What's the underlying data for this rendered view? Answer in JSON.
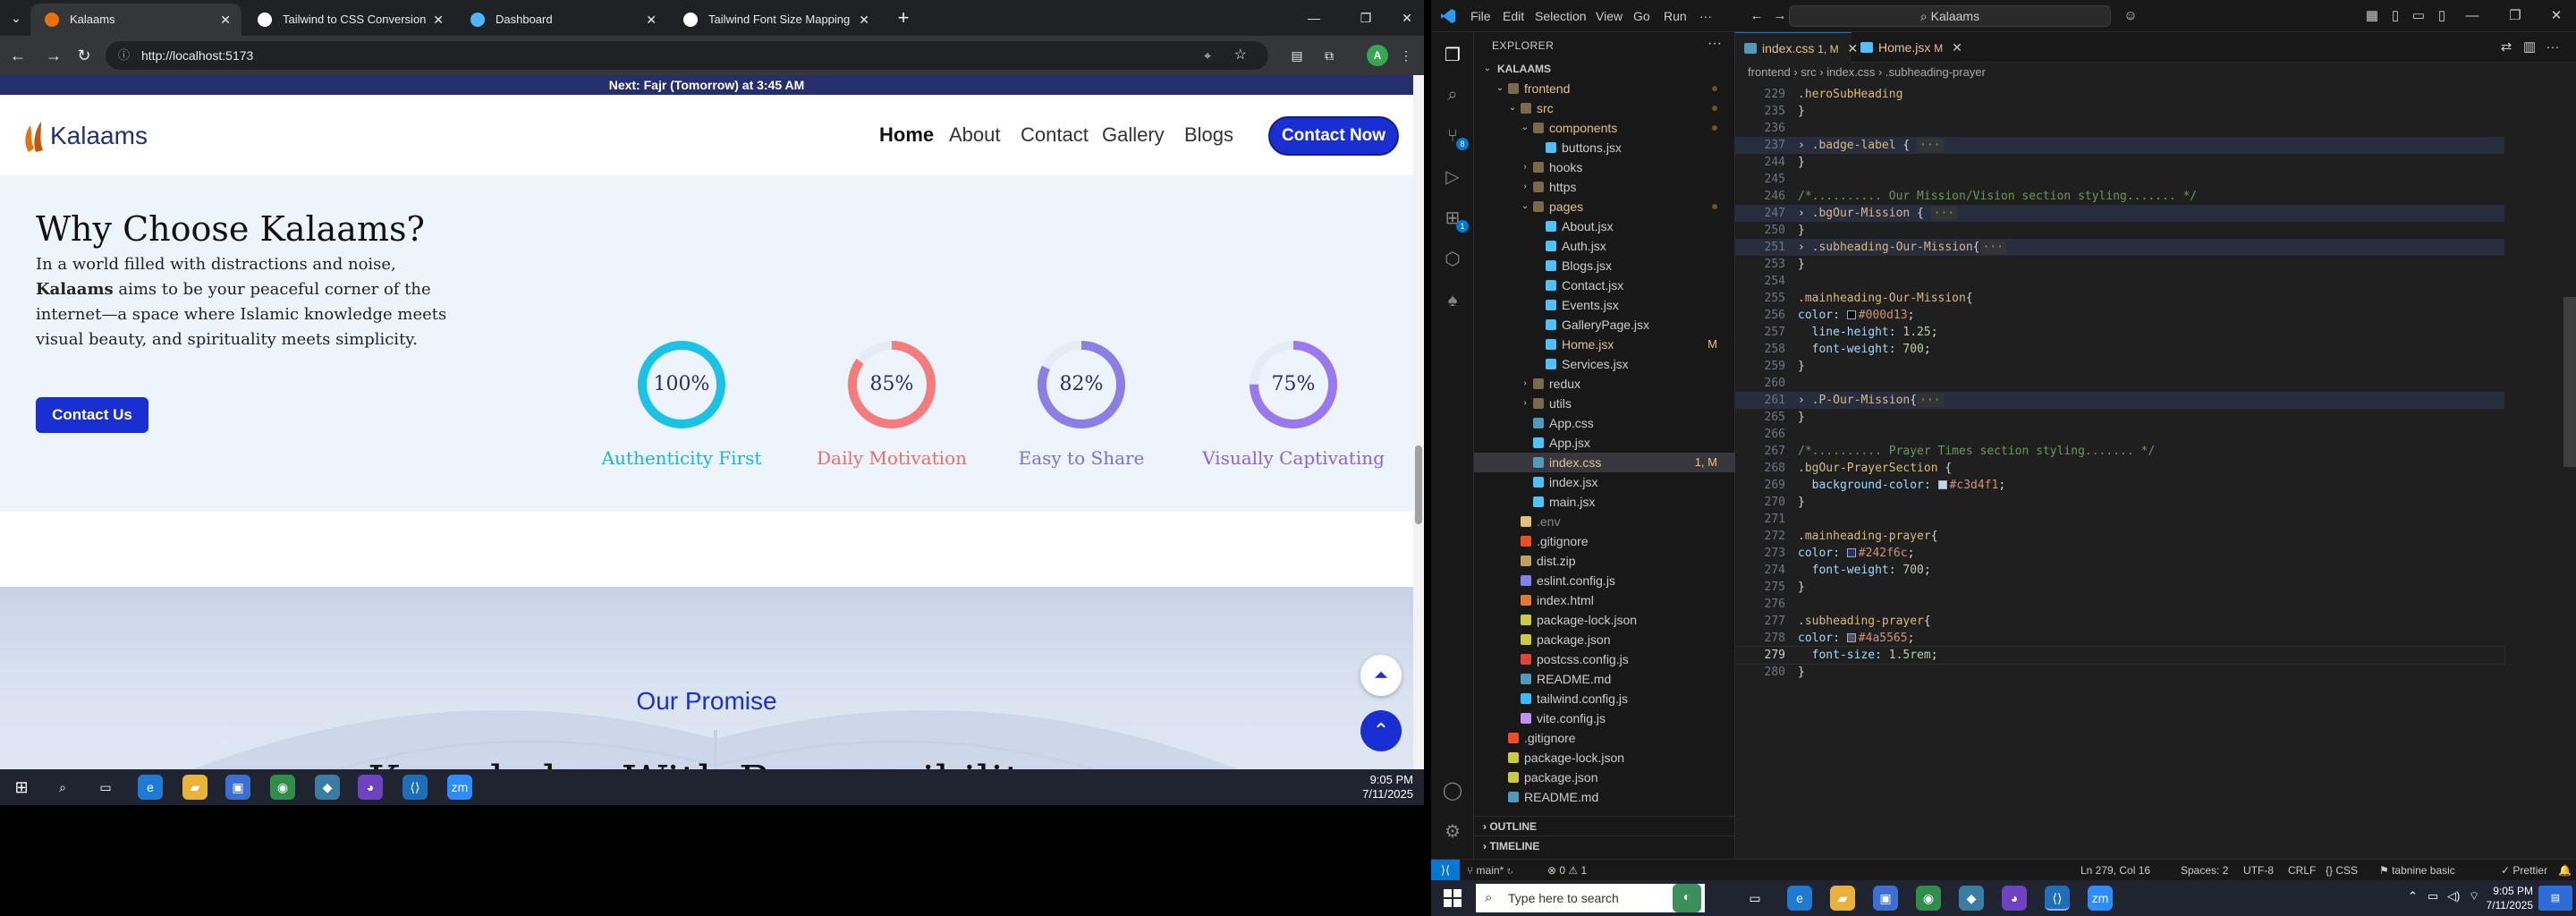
{
  "browser": {
    "tabs": [
      {
        "title": "Kalaams",
        "favicon_color": "#e8710a",
        "active": true
      },
      {
        "title": "Tailwind to CSS Conversion",
        "favicon_color": "#ffffff",
        "active": false
      },
      {
        "title": "Dashboard",
        "favicon_color": "#4db6ff",
        "active": false
      },
      {
        "title": "Tailwind Font Size Mapping",
        "favicon_color": "#ffffff",
        "active": false
      }
    ],
    "url": "http://localhost:5173",
    "avatar_letter": "A"
  },
  "site": {
    "notice_prefix": "Next: ",
    "notice_bold": "Fajr (Tomorrow)",
    "notice_suffix": " at 3:45 AM",
    "logo_text": "Kalaams",
    "nav": [
      "Home",
      "About",
      "Contact",
      "Gallery",
      "Blogs"
    ],
    "cta": "Contact Now",
    "why_title": "Why Choose Kalaams?",
    "why_p1": "In a world filled with distractions and noise,",
    "why_bold": "Kalaams",
    "why_p2": " aims to be your peaceful corner of the internet—a space where Islamic knowledge meets visual beauty, and spirituality meets simplicity.",
    "contact_btn": "Contact Us",
    "stats": [
      {
        "value": 100,
        "label": "100%",
        "title": "Authenticity First",
        "color": "#1ac3e6",
        "title_color": "#1bb4d4"
      },
      {
        "value": 85,
        "label": "85%",
        "title": "Daily Motivation",
        "color": "#f47c7c",
        "title_color": "#f06a6a"
      },
      {
        "value": 82,
        "label": "82%",
        "title": "Easy to Share",
        "color": "#8b7fe6",
        "title_color": "#7a6fde"
      },
      {
        "value": 75,
        "label": "75%",
        "title": "Visually Captivating",
        "color": "#9a78ee",
        "title_color": "#8a62e6"
      }
    ],
    "promise_sub": "Our Promise",
    "promise_title": "Knowledge With Responsibility"
  },
  "left_taskbar": {
    "time": "9:05 PM",
    "date": "7/11/2025"
  },
  "vscode": {
    "menu": [
      "File",
      "Edit",
      "Selection",
      "View",
      "Go",
      "Run",
      "···"
    ],
    "search": "Kalaams",
    "explorer_title": "EXPLORER",
    "tree": [
      {
        "depth": 0,
        "type": "folder-open",
        "name": "KALAAMS",
        "bold": true
      },
      {
        "depth": 1,
        "type": "folder-open",
        "name": "frontend",
        "color": "#e2c08d",
        "dot": true
      },
      {
        "depth": 2,
        "type": "folder-open",
        "name": "src",
        "color": "#e2c08d",
        "dot": true
      },
      {
        "depth": 3,
        "type": "folder-open",
        "name": "components",
        "color": "#e2c08d",
        "dot": true
      },
      {
        "depth": 4,
        "type": "file",
        "name": "buttons.jsx",
        "icon": "#4fc1ff"
      },
      {
        "depth": 3,
        "type": "folder",
        "name": "hooks"
      },
      {
        "depth": 3,
        "type": "folder",
        "name": "https"
      },
      {
        "depth": 3,
        "type": "folder-open",
        "name": "pages",
        "color": "#e2c08d",
        "dot": true
      },
      {
        "depth": 4,
        "type": "file",
        "name": "About.jsx",
        "icon": "#4fc1ff"
      },
      {
        "depth": 4,
        "type": "file",
        "name": "Auth.jsx",
        "icon": "#4fc1ff"
      },
      {
        "depth": 4,
        "type": "file",
        "name": "Blogs.jsx",
        "icon": "#4fc1ff"
      },
      {
        "depth": 4,
        "type": "file",
        "name": "Contact.jsx",
        "icon": "#4fc1ff"
      },
      {
        "depth": 4,
        "type": "file",
        "name": "Events.jsx",
        "icon": "#4fc1ff"
      },
      {
        "depth": 4,
        "type": "file",
        "name": "GalleryPage.jsx",
        "icon": "#4fc1ff"
      },
      {
        "depth": 4,
        "type": "file",
        "name": "Home.jsx",
        "icon": "#4fc1ff",
        "color": "#e2c08d",
        "status": "M",
        "status_color": "#e2c08d"
      },
      {
        "depth": 4,
        "type": "file",
        "name": "Services.jsx",
        "icon": "#4fc1ff"
      },
      {
        "depth": 3,
        "type": "folder",
        "name": "redux"
      },
      {
        "depth": 3,
        "type": "folder",
        "name": "utils"
      },
      {
        "depth": 3,
        "type": "file",
        "name": "App.css",
        "icon": "#519aba"
      },
      {
        "depth": 3,
        "type": "file",
        "name": "App.jsx",
        "icon": "#4fc1ff"
      },
      {
        "depth": 3,
        "type": "file",
        "name": "index.css",
        "icon": "#519aba",
        "color": "#e2c08d",
        "status": "1, M",
        "status_color": "#e2c08d",
        "selected": true
      },
      {
        "depth": 3,
        "type": "file",
        "name": "index.jsx",
        "icon": "#4fc1ff"
      },
      {
        "depth": 3,
        "type": "file",
        "name": "main.jsx",
        "icon": "#4fc1ff"
      },
      {
        "depth": 2,
        "type": "file",
        "name": ".env",
        "icon": "#e5c07b",
        "color": "#8b8b8b"
      },
      {
        "depth": 2,
        "type": "file",
        "name": ".gitignore",
        "icon": "#f14c28"
      },
      {
        "depth": 2,
        "type": "file",
        "name": "dist.zip",
        "icon": "#c0a060"
      },
      {
        "depth": 2,
        "type": "file",
        "name": "eslint.config.js",
        "icon": "#8080f0"
      },
      {
        "depth": 2,
        "type": "file",
        "name": "index.html",
        "icon": "#e37933"
      },
      {
        "depth": 2,
        "type": "file",
        "name": "package-lock.json",
        "icon": "#cbcb41"
      },
      {
        "depth": 2,
        "type": "file",
        "name": "package.json",
        "icon": "#cbcb41"
      },
      {
        "depth": 2,
        "type": "file",
        "name": "postcss.config.js",
        "icon": "#e0433c"
      },
      {
        "depth": 2,
        "type": "file",
        "name": "README.md",
        "icon": "#519aba"
      },
      {
        "depth": 2,
        "type": "file",
        "name": "tailwind.config.js",
        "icon": "#38bdf8"
      },
      {
        "depth": 2,
        "type": "file",
        "name": "vite.config.js",
        "icon": "#bd93f9"
      },
      {
        "depth": 1,
        "type": "file",
        "name": ".gitignore",
        "icon": "#f14c28"
      },
      {
        "depth": 1,
        "type": "file",
        "name": "package-lock.json",
        "icon": "#cbcb41"
      },
      {
        "depth": 1,
        "type": "file",
        "name": "package.json",
        "icon": "#cbcb41"
      },
      {
        "depth": 1,
        "type": "file",
        "name": "README.md",
        "icon": "#519aba"
      }
    ],
    "outline": "OUTLINE",
    "timeline": "TIMELINE",
    "tabs": [
      {
        "name": "index.css",
        "badge": "1, M",
        "color": "#e2c08d",
        "icon": "#519aba",
        "active": true
      },
      {
        "name": "Home.jsx",
        "badge": "M",
        "color": "#e2c08d",
        "icon": "#4fc1ff",
        "active": false
      }
    ],
    "breadcrumb": "frontend  ›  src  ›  index.css  ›  .subheading-prayer",
    "lines": [
      {
        "n": "229",
        "parts": [
          {
            "t": ".heroSubHeading",
            "c": "c-sel"
          }
        ]
      },
      {
        "n": "235",
        "parts": [
          {
            "t": "}",
            "c": "c-brace"
          }
        ]
      },
      {
        "n": "236",
        "parts": []
      },
      {
        "n": "237",
        "fold": true,
        "parts": [
          {
            "t": "› ",
            "c": "c-brace"
          },
          {
            "t": ".badge-label",
            "c": "c-sel"
          },
          {
            "t": " { ",
            "c": "c-brace"
          },
          {
            "t": "···",
            "c": "c-fold"
          }
        ]
      },
      {
        "n": "244",
        "parts": [
          {
            "t": "}",
            "c": "c-brace"
          }
        ]
      },
      {
        "n": "245",
        "parts": []
      },
      {
        "n": "246",
        "parts": [
          {
            "t": "/*.......... Our Mission/Vision section styling....... */",
            "c": "c-cmt"
          }
        ]
      },
      {
        "n": "247",
        "fold": true,
        "parts": [
          {
            "t": "› ",
            "c": "c-brace"
          },
          {
            "t": ".bgOur-Mission",
            "c": "c-sel"
          },
          {
            "t": " { ",
            "c": "c-brace"
          },
          {
            "t": "···",
            "c": "c-fold"
          }
        ]
      },
      {
        "n": "250",
        "parts": [
          {
            "t": "}",
            "c": "c-brace"
          }
        ]
      },
      {
        "n": "251",
        "fold": true,
        "parts": [
          {
            "t": "› ",
            "c": "c-brace"
          },
          {
            "t": ".subheading-Our-Mission",
            "c": "c-sel"
          },
          {
            "t": "{",
            "c": "c-brace"
          },
          {
            "t": "···",
            "c": "c-fold"
          }
        ]
      },
      {
        "n": "253",
        "parts": [
          {
            "t": "}",
            "c": "c-brace"
          }
        ]
      },
      {
        "n": "254",
        "parts": []
      },
      {
        "n": "255",
        "parts": [
          {
            "t": ".mainheading-Our-Mission",
            "c": "c-sel"
          },
          {
            "t": "{",
            "c": "c-brace"
          }
        ]
      },
      {
        "n": "256",
        "parts": [
          {
            "t": "color: ",
            "c": "c-prop"
          },
          {
            "t": "■",
            "c": "swatch-000d13"
          },
          {
            "t": "#000d13",
            "c": "c-val"
          },
          {
            "t": ";",
            "c": "c-brace"
          }
        ]
      },
      {
        "n": "257",
        "parts": [
          {
            "t": "  line-height: ",
            "c": "c-prop"
          },
          {
            "t": "1.25",
            "c": "c-num"
          },
          {
            "t": ";",
            "c": "c-brace"
          }
        ]
      },
      {
        "n": "258",
        "parts": [
          {
            "t": "  font-weight: ",
            "c": "c-prop"
          },
          {
            "t": "700",
            "c": "c-num"
          },
          {
            "t": ";",
            "c": "c-brace"
          }
        ]
      },
      {
        "n": "259",
        "parts": [
          {
            "t": "}",
            "c": "c-brace"
          }
        ]
      },
      {
        "n": "260",
        "parts": []
      },
      {
        "n": "261",
        "fold": true,
        "parts": [
          {
            "t": "› ",
            "c": "c-brace"
          },
          {
            "t": ".P-Our-Mission",
            "c": "c-sel"
          },
          {
            "t": "{",
            "c": "c-brace"
          },
          {
            "t": "···",
            "c": "c-fold"
          }
        ]
      },
      {
        "n": "265",
        "parts": [
          {
            "t": "}",
            "c": "c-brace"
          }
        ]
      },
      {
        "n": "266",
        "parts": []
      },
      {
        "n": "267",
        "parts": [
          {
            "t": "/*.......... Prayer Times section styling....... */",
            "c": "c-cmt"
          }
        ]
      },
      {
        "n": "268",
        "parts": [
          {
            "t": ".bgOur-PrayerSection",
            "c": "c-sel"
          },
          {
            "t": " {",
            "c": "c-brace"
          }
        ]
      },
      {
        "n": "269",
        "parts": [
          {
            "t": "  background-color: ",
            "c": "c-prop"
          },
          {
            "t": "■",
            "c": "swatch-c3d4f1"
          },
          {
            "t": "#c3d4f1",
            "c": "c-val"
          },
          {
            "t": ";",
            "c": "c-brace"
          }
        ]
      },
      {
        "n": "270",
        "parts": [
          {
            "t": "}",
            "c": "c-brace"
          }
        ]
      },
      {
        "n": "271",
        "parts": []
      },
      {
        "n": "272",
        "parts": [
          {
            "t": ".mainheading-prayer",
            "c": "c-sel"
          },
          {
            "t": "{",
            "c": "c-brace"
          }
        ]
      },
      {
        "n": "273",
        "parts": [
          {
            "t": "color: ",
            "c": "c-prop"
          },
          {
            "t": "■",
            "c": "swatch-242f6c"
          },
          {
            "t": "#242f6c",
            "c": "c-val"
          },
          {
            "t": ";",
            "c": "c-brace"
          }
        ]
      },
      {
        "n": "274",
        "parts": [
          {
            "t": "  font-weight: ",
            "c": "c-prop"
          },
          {
            "t": "700",
            "c": "c-num"
          },
          {
            "t": ";",
            "c": "c-brace"
          }
        ]
      },
      {
        "n": "275",
        "parts": [
          {
            "t": "}",
            "c": "c-brace"
          }
        ]
      },
      {
        "n": "276",
        "parts": []
      },
      {
        "n": "277",
        "parts": [
          {
            "t": ".subheading-prayer",
            "c": "c-sel"
          },
          {
            "t": "{",
            "c": "c-brace"
          }
        ]
      },
      {
        "n": "278",
        "parts": [
          {
            "t": "color: ",
            "c": "c-prop"
          },
          {
            "t": "■",
            "c": "swatch-4a5565"
          },
          {
            "t": "#4a5565",
            "c": "c-val"
          },
          {
            "t": ";",
            "c": "c-brace"
          }
        ]
      },
      {
        "n": "279",
        "current": true,
        "parts": [
          {
            "t": "  font-size: ",
            "c": "c-prop"
          },
          {
            "t": "1.5rem",
            "c": "c-num"
          },
          {
            "t": ";",
            "c": "c-brace"
          }
        ]
      },
      {
        "n": "280",
        "parts": [
          {
            "t": "}",
            "c": "c-brace"
          }
        ]
      }
    ],
    "status": {
      "branch": "main*",
      "problems": "⊗ 0 ⚠ 1",
      "position": "Ln 279, Col 16",
      "spaces": "Spaces: 2",
      "encoding": "UTF-8",
      "eol": "CRLF",
      "lang": "CSS",
      "tabnine": "tabnine basic",
      "prettier": "Prettier"
    }
  },
  "taskbar": {
    "search_placeholder": "Type here to search",
    "time": "9:05 PM",
    "date": "7/11/2025"
  }
}
